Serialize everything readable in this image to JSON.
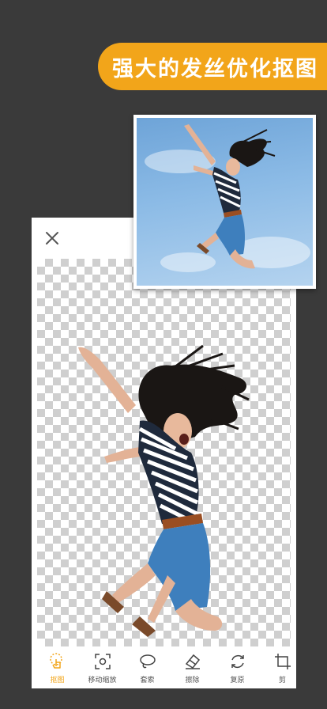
{
  "banner": {
    "text": "强大的发丝优化抠图"
  },
  "colors": {
    "accent": "#f2a51a",
    "background": "#3a3a3a"
  },
  "editor": {
    "close_icon": "close-icon"
  },
  "toolbar": {
    "items": [
      {
        "label": "抠图",
        "icon": "tap-hand-icon",
        "active": true
      },
      {
        "label": "移动缩放",
        "icon": "move-zoom-icon",
        "active": false
      },
      {
        "label": "套索",
        "icon": "lasso-icon",
        "active": false
      },
      {
        "label": "擦除",
        "icon": "eraser-icon",
        "active": false
      },
      {
        "label": "复原",
        "icon": "restore-icon",
        "active": false
      },
      {
        "label": "剪",
        "icon": "crop-icon",
        "active": false
      }
    ]
  }
}
